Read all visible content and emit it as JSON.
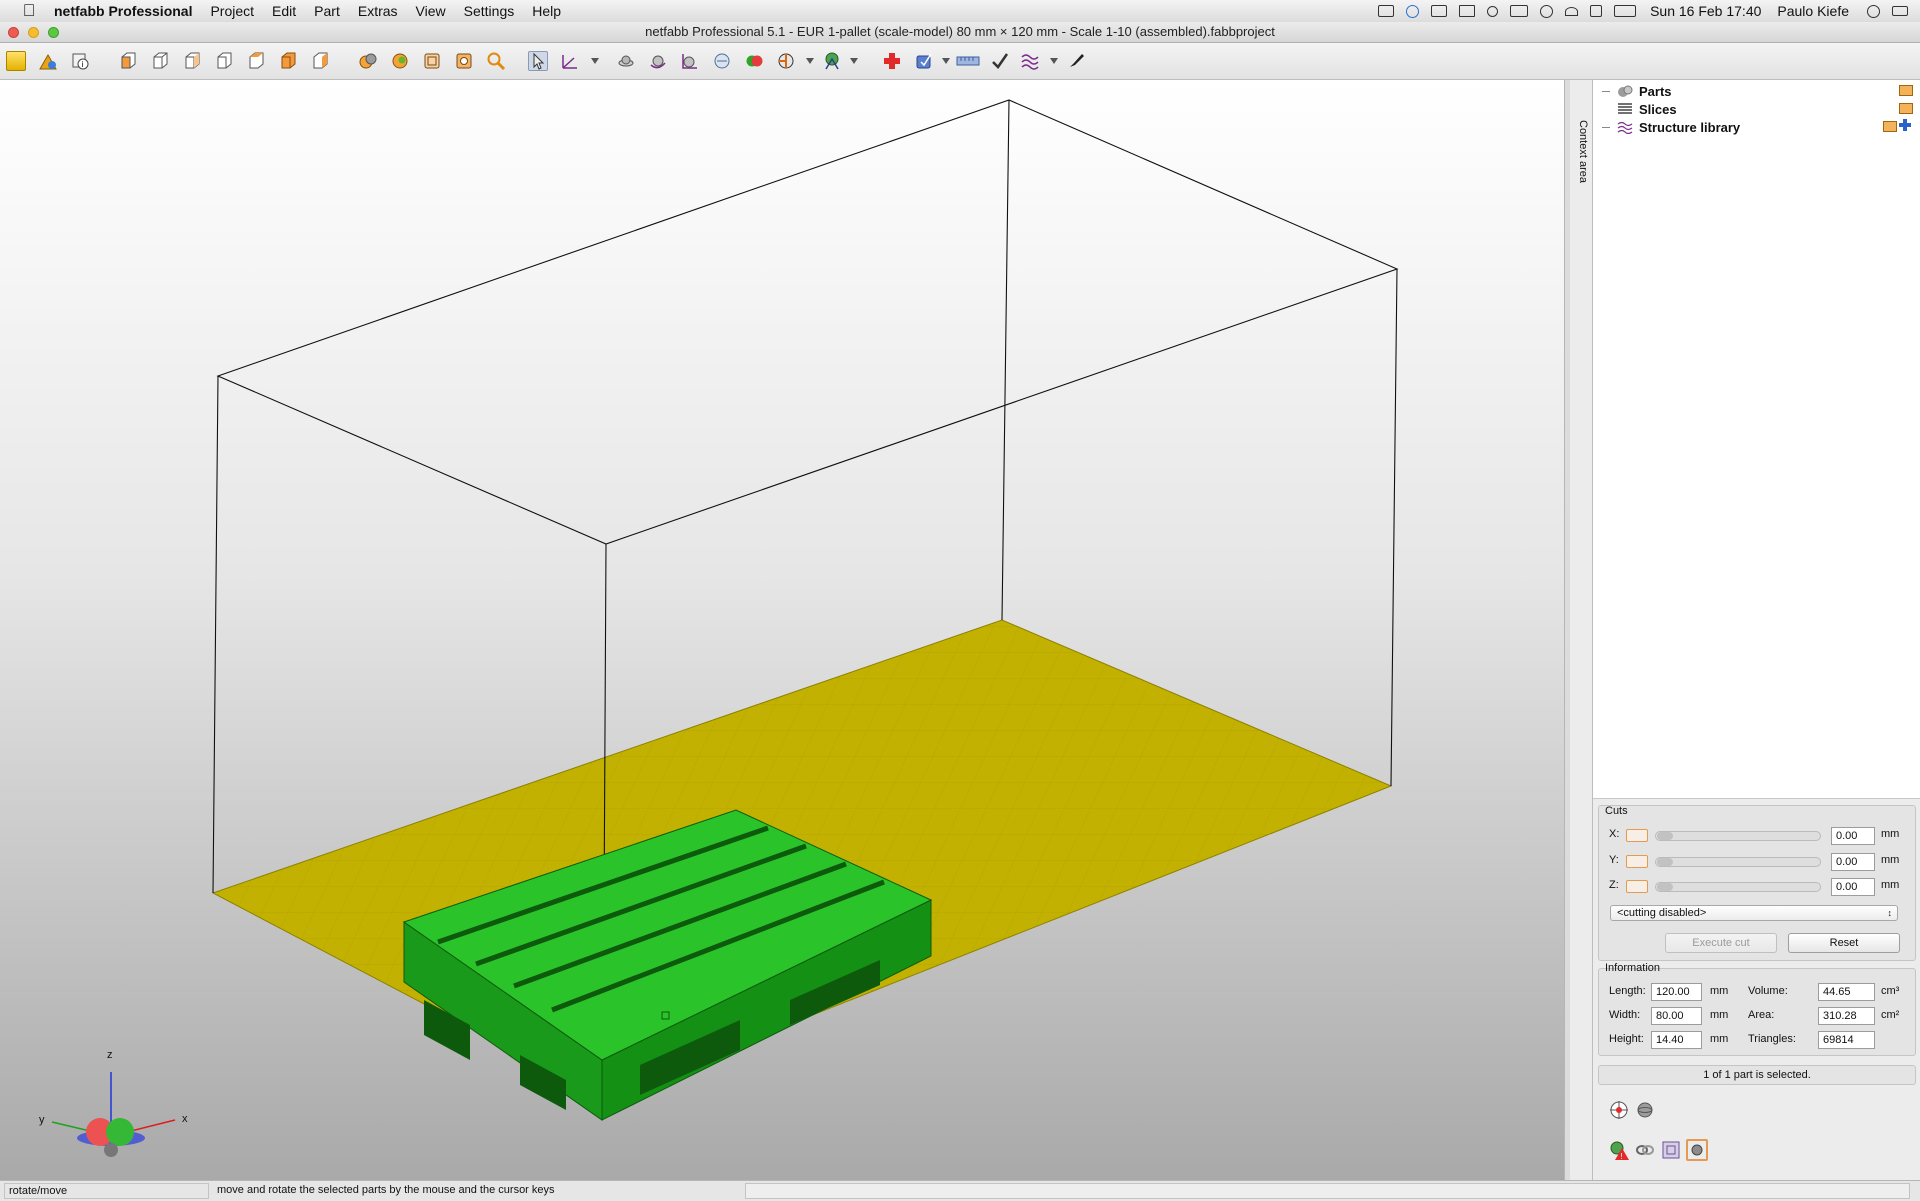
{
  "menubar": {
    "app_name": "netfabb Professional",
    "menus": [
      "Project",
      "Edit",
      "Part",
      "Extras",
      "View",
      "Settings",
      "Help"
    ],
    "datetime": "Sun 16 Feb  17:40",
    "user": "Paulo Kiefe"
  },
  "window": {
    "title": "netfabb Professional 5.1 - EUR 1-pallet (scale-model) 80 mm × 120 mm - Scale 1-10 (assembled).fabbproject"
  },
  "toolbar": {
    "icons": [
      "open-project-icon",
      "add-part-icon",
      "part-info-icon",
      "view-front-icon",
      "view-back-icon",
      "view-left-icon",
      "view-right-icon",
      "view-top-icon",
      "view-bottom-icon",
      "view-iso-icon",
      "color-parts-icon",
      "shade-parts-icon",
      "wireframe-icon",
      "zoom-selection-icon",
      "zoom-icon",
      "select-pointer-icon",
      "measure-icon",
      "move-part-icon",
      "rotate-part-icon",
      "scale-part-icon",
      "mirror-icon",
      "boolean-icon",
      "slice-icon",
      "support-icon",
      "repair-icon",
      "analyze-icon",
      "ruler-icon",
      "check-icon",
      "structure-icon",
      "brush-icon"
    ]
  },
  "viewport": {
    "axes": {
      "x": "x",
      "y": "y",
      "z": "z"
    },
    "colors": {
      "platform": "#c2b100",
      "part": "#22c422",
      "part_dark": "#137a13",
      "frame": "#111111"
    }
  },
  "context_area": {
    "label": "Context area"
  },
  "tree": {
    "items": [
      {
        "label": "Parts",
        "icon": "parts-icon"
      },
      {
        "label": "Slices",
        "icon": "slices-icon"
      },
      {
        "label": "Structure library",
        "icon": "structure-library-icon"
      }
    ]
  },
  "cuts": {
    "title": "Cuts",
    "axes": [
      {
        "label": "X:",
        "value": "0.00",
        "unit": "mm"
      },
      {
        "label": "Y:",
        "value": "0.00",
        "unit": "mm"
      },
      {
        "label": "Z:",
        "value": "0.00",
        "unit": "mm"
      }
    ],
    "mode": "<cutting disabled>",
    "execute_label": "Execute cut",
    "reset_label": "Reset"
  },
  "information": {
    "title": "Information",
    "length": {
      "label": "Length:",
      "value": "120.00",
      "unit": "mm"
    },
    "width": {
      "label": "Width:",
      "value": "80.00",
      "unit": "mm"
    },
    "height": {
      "label": "Height:",
      "value": "14.40",
      "unit": "mm"
    },
    "volume": {
      "label": "Volume:",
      "value": "44.65",
      "unit": "cm³"
    },
    "area": {
      "label": "Area:",
      "value": "310.28",
      "unit": "cm²"
    },
    "triangles": {
      "label": "Triangles:",
      "value": "69814"
    },
    "selection_status": "1 of 1 part is selected."
  },
  "statusbar": {
    "mode": "rotate/move",
    "hint": "move and rotate the selected parts by the mouse and the cursor keys"
  }
}
